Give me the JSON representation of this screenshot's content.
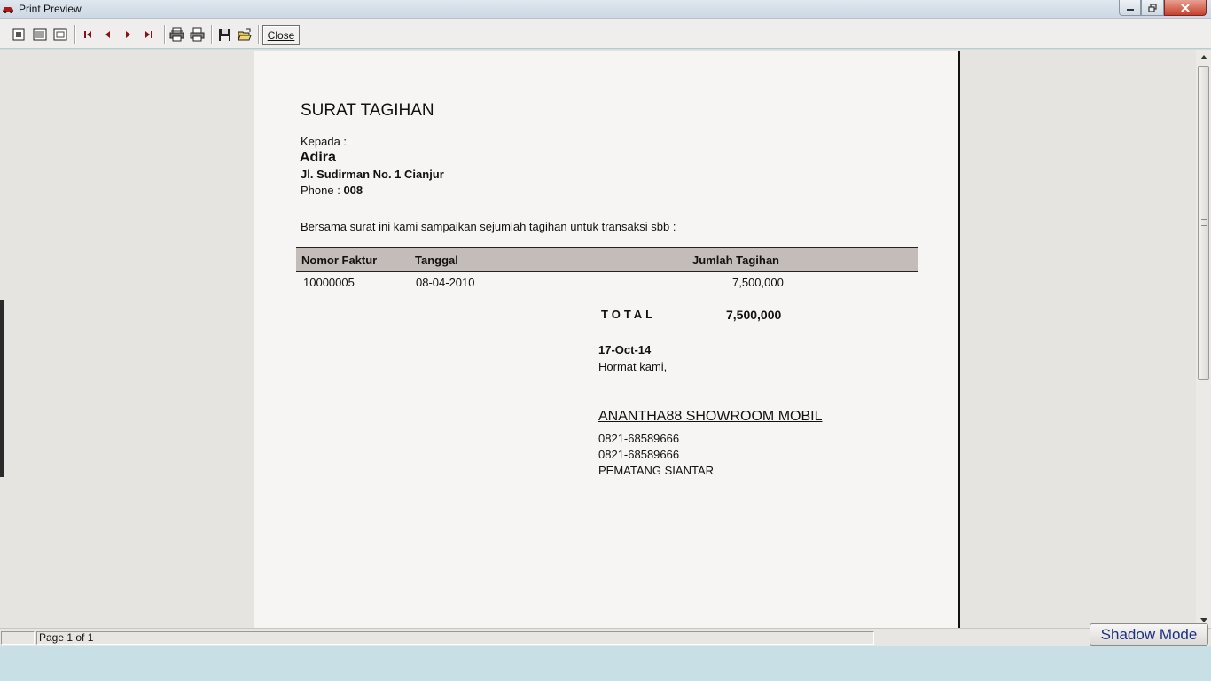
{
  "window": {
    "title": "Print Preview",
    "controls": {
      "minimize": "minimize-icon",
      "maximize": "restore-icon",
      "close": "close-icon"
    }
  },
  "toolbar": {
    "buttons": [
      {
        "name": "one-page-view",
        "icon": "single-page-icon"
      },
      {
        "name": "page-width-view",
        "icon": "page-width-icon"
      },
      {
        "name": "fit-page-view",
        "icon": "fit-page-icon"
      },
      {
        "name": "first-page",
        "icon": "first-page-icon"
      },
      {
        "name": "previous-page",
        "icon": "previous-page-icon"
      },
      {
        "name": "next-page",
        "icon": "next-page-icon"
      },
      {
        "name": "last-page",
        "icon": "last-page-icon"
      },
      {
        "name": "print-setup",
        "icon": "printer-setup-icon"
      },
      {
        "name": "print",
        "icon": "printer-icon"
      },
      {
        "name": "save",
        "icon": "floppy-disk-icon"
      },
      {
        "name": "open",
        "icon": "open-folder-icon"
      }
    ],
    "close_label": "Close"
  },
  "document": {
    "title": "SURAT TAGIHAN",
    "kepada_label": "Kepada :",
    "recipient_name": "Adira",
    "recipient_address": "Jl. Sudirman No. 1 Cianjur",
    "phone_label": "Phone : ",
    "phone_value": "008",
    "intro": "Bersama surat ini kami sampaikan sejumlah tagihan untuk transaksi sbb :",
    "table": {
      "headers": [
        "Nomor Faktur",
        "Tanggal",
        "Jumlah Tagihan"
      ],
      "rows": [
        [
          "10000005",
          "08-04-2010",
          "7,500,000"
        ]
      ]
    },
    "total_label": "TOTAL",
    "total_value": "7,500,000",
    "date": "17-Oct-14",
    "closing": "Hormat kami,",
    "company": "ANANTHA88 SHOWROOM MOBIL",
    "company_phone_1": "0821-68589666",
    "company_phone_2": "0821-68589666",
    "company_city": "PEMATANG SIANTAR"
  },
  "statusbar": {
    "page_info": "Page 1 of 1"
  },
  "shadow_mode_label": "Shadow Mode",
  "colors": {
    "table_header_bg": "#c4bcb8",
    "shadow_mode_text": "#1b2f86",
    "close_button_red": "#c7402c"
  }
}
